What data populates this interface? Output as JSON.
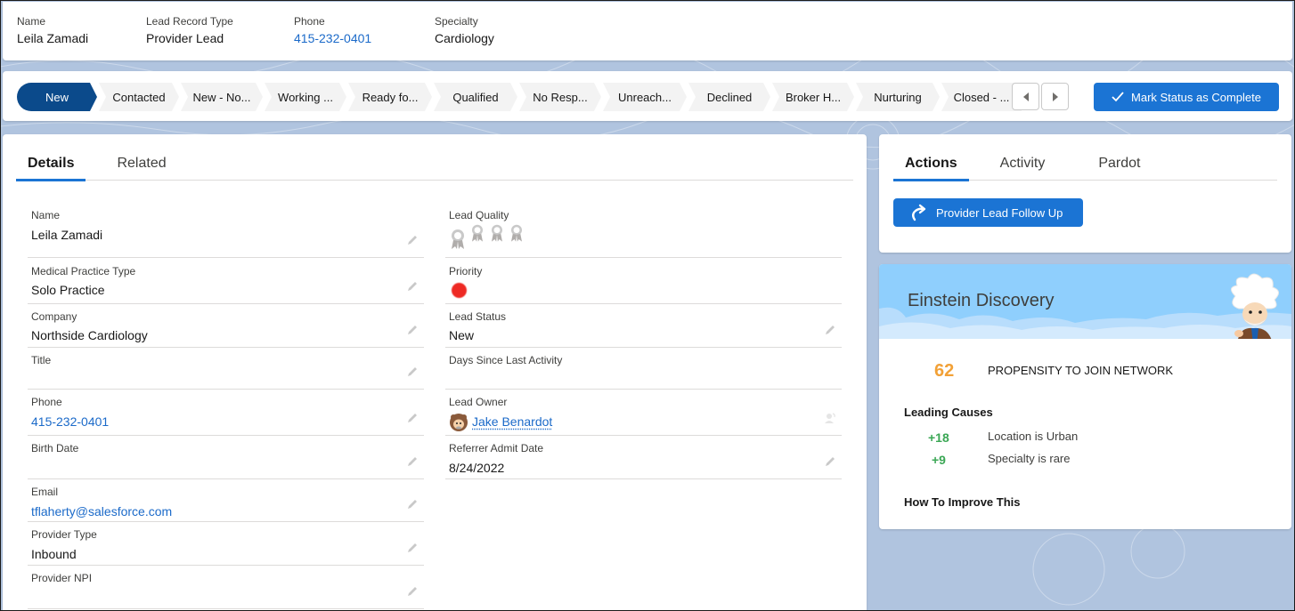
{
  "highlights": {
    "fields": [
      {
        "label": "Name",
        "value": "Leila Zamadi"
      },
      {
        "label": "Lead Record Type",
        "value": "Provider Lead"
      },
      {
        "label": "Phone",
        "value": "415-232-0401"
      },
      {
        "label": "Specialty",
        "value": "Cardiology"
      }
    ]
  },
  "path": {
    "stages": [
      "New",
      "Contacted",
      "New - No...",
      "Working ...",
      "Ready fo...",
      "Qualified",
      "No Resp...",
      "Unreach...",
      "Declined",
      "Broker H...",
      "Nurturing",
      "Closed - ..."
    ],
    "current": "New",
    "mark_complete_label": "Mark Status as Complete",
    "active_color": "#0b4a8b"
  },
  "details": {
    "tabs": [
      "Details",
      "Related"
    ],
    "active_tab": "Details",
    "left_fields": [
      {
        "label": "Name",
        "value": "Leila Zamadi"
      },
      {
        "label": "Medical Practice Type",
        "value": "Solo Practice"
      },
      {
        "label": "Company",
        "value": "Northside Cardiology"
      },
      {
        "label": "Title",
        "value": ""
      },
      {
        "label": "Phone",
        "value": "415-232-0401"
      },
      {
        "label": "Birth Date",
        "value": ""
      },
      {
        "label": "Email",
        "value": "tflaherty@salesforce.com"
      },
      {
        "label": "Provider Type",
        "value": "Inbound"
      },
      {
        "label": "Provider NPI",
        "value": ""
      }
    ],
    "right_fields": [
      {
        "label": "Lead Quality",
        "value": "",
        "icon": "award-ribbon-icon",
        "rating": 0,
        "rating_max": 4
      },
      {
        "label": "Priority",
        "value": "",
        "icon": "red-dot-icon",
        "color": "#ee2a24"
      },
      {
        "label": "Lead Status",
        "value": "New"
      },
      {
        "label": "Days Since Last Activity",
        "value": ""
      },
      {
        "label": "Lead Owner",
        "value": "Jake Benardot"
      },
      {
        "label": "Referrer Admit Date",
        "value": "8/24/2022"
      }
    ]
  },
  "actions": {
    "tabs": [
      "Actions",
      "Activity",
      "Pardot"
    ],
    "active_tab": "Actions",
    "flow_button_label": "Provider Lead Follow Up"
  },
  "einstein": {
    "title": "Einstein Discovery",
    "score": "62",
    "score_label": "PROPENSITY TO JOIN NETWORK",
    "score_color": "#f2a137",
    "leading_causes_title": "Leading Causes",
    "causes": [
      {
        "value": "+18",
        "text": "Location is Urban"
      },
      {
        "value": "+9",
        "text": "Specialty is rare"
      }
    ],
    "improve_title": "How To Improve This"
  }
}
